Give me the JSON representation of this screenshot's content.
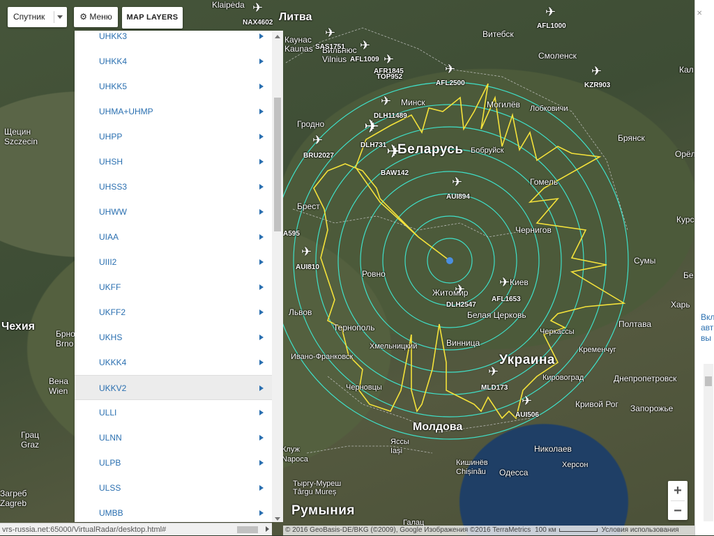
{
  "controls": {
    "map_type": "Спутник",
    "menu_label": "Меню",
    "layers_label": "MAP LAYERS"
  },
  "menu_items": [
    {
      "label": "UHKK3",
      "active": false
    },
    {
      "label": "UHKK4",
      "active": false
    },
    {
      "label": "UHKK5",
      "active": false
    },
    {
      "label": "UHMA+UHMP",
      "active": false
    },
    {
      "label": "UHPP",
      "active": false
    },
    {
      "label": "UHSH",
      "active": false
    },
    {
      "label": "UHSS3",
      "active": false
    },
    {
      "label": "UHWW",
      "active": false
    },
    {
      "label": "UIAA",
      "active": false
    },
    {
      "label": "UIII2",
      "active": false
    },
    {
      "label": "UKFF",
      "active": false
    },
    {
      "label": "UKFF2",
      "active": false
    },
    {
      "label": "UKHS",
      "active": false
    },
    {
      "label": "UKKK4",
      "active": false
    },
    {
      "label": "UKKV2",
      "active": true
    },
    {
      "label": "ULLI",
      "active": false
    },
    {
      "label": "ULNN",
      "active": false
    },
    {
      "label": "ULPB",
      "active": false
    },
    {
      "label": "ULSS",
      "active": false
    },
    {
      "label": "UMBB",
      "active": false
    }
  ],
  "status_url": "vrs-russia.net:65000/VirtualRadar/desktop.html#",
  "attribution": {
    "copyright": "© 2016 GeoBasis-DE/BKG (©2009), Google Изображения ©2016 TerraMetrics",
    "scale": "100 км",
    "terms": "Условия использования"
  },
  "zoom": {
    "in": "+",
    "out": "−"
  },
  "countries": {
    "lithuania": "Литва",
    "belarus": "Беларусь",
    "ukraine": "Украина",
    "moldova": "Молдова",
    "romania": "Румыния",
    "czech": "Чехия"
  },
  "cities": {
    "klaipeda": "Klaipėda",
    "kaunas": "Каунас Kaunas",
    "vilnius": "Вильнюс Vilnius",
    "vitebsk": "Витебск",
    "smolensk": "Смоленск",
    "minsk": "Минск",
    "grodno": "Гродно",
    "mogilev": "Могилёв",
    "lobkovichi": "Лобковичи",
    "bobruisk": "Бобруйск",
    "bryansk": "Брянск",
    "orel": "Орёл",
    "gomel": "Гомель",
    "brest": "Брест",
    "chernigov": "Чернигов",
    "sumy": "Сумы",
    "rovno": "Ровно",
    "zhitomir": "Житомир",
    "kiev": "Киев",
    "lviv": "Львов",
    "ternopol": "Тернополь",
    "belaya": "Белая Церковь",
    "poltava": "Полтава",
    "kharkov": "Харь",
    "khmelnitsky": "Хмельницкий",
    "vinnitsa": "Винница",
    "cherkassy": "Черкассы",
    "kremenchug": "Кременчуг",
    "ivano": "Ивано-Франковск",
    "chernovtsy": "Черновцы",
    "kirovograd": "Кировоград",
    "dnepr": "Днепропетровск",
    "krivoy": "Кривой Рог",
    "zaporozhye": "Запорожье",
    "nikolaev": "Николаев",
    "kherson": "Херсон",
    "odessa": "Одесса",
    "yassy": "Яссы Iași",
    "kishinev": "Кишинёв Chișinău",
    "kluzh": "Клуж Napoca",
    "tyrgu": "Тыргу-Муреш Târgu Mureș",
    "galati": "Галац",
    "szczecin": "Щецин Szczecin",
    "graz": "Грац Graz",
    "zagreb": "Загреб Zagreb",
    "vienna": "Вена Wien",
    "brno": "Брно Brno",
    "kaluga": "Кал",
    "kursk": "Курс",
    "be": "Бе"
  },
  "aircraft": [
    "NAX4602",
    "AFL1000",
    "SAS1751",
    "AFL1009",
    "AFR1845",
    "TOP952",
    "AFL2500",
    "KZR903",
    "DLH11489",
    "DLH731",
    "BRU2027",
    "BAW142",
    "AUI894",
    "A595",
    "AUI810",
    "DLH2547",
    "AFL1653",
    "MLD173",
    "AUI506"
  ],
  "right_pane": {
    "text": "Вкл авт вы"
  }
}
